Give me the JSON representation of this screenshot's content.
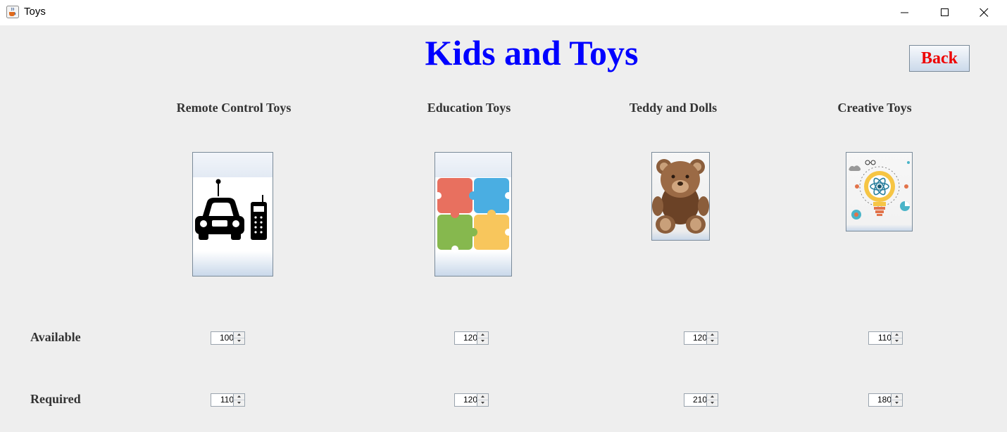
{
  "window": {
    "title": "Toys",
    "icon": "java-cup-icon"
  },
  "header": {
    "title": "Kids and Toys",
    "back_label": "Back",
    "title_color": "#0000ff",
    "back_color": "#ee0000"
  },
  "categories": [
    {
      "label": "Remote Control Toys",
      "icon": "remote-control-car-icon",
      "available": "100",
      "required": "110"
    },
    {
      "label": "Education Toys",
      "icon": "puzzle-pieces-icon",
      "available": "120",
      "required": "120"
    },
    {
      "label": "Teddy and Dolls",
      "icon": "teddy-bear-icon",
      "available": "120",
      "required": "210"
    },
    {
      "label": "Creative Toys",
      "icon": "lightbulb-atom-icon",
      "available": "110",
      "required": "180"
    }
  ],
  "rows": {
    "available_label": "Available",
    "required_label": "Required"
  }
}
